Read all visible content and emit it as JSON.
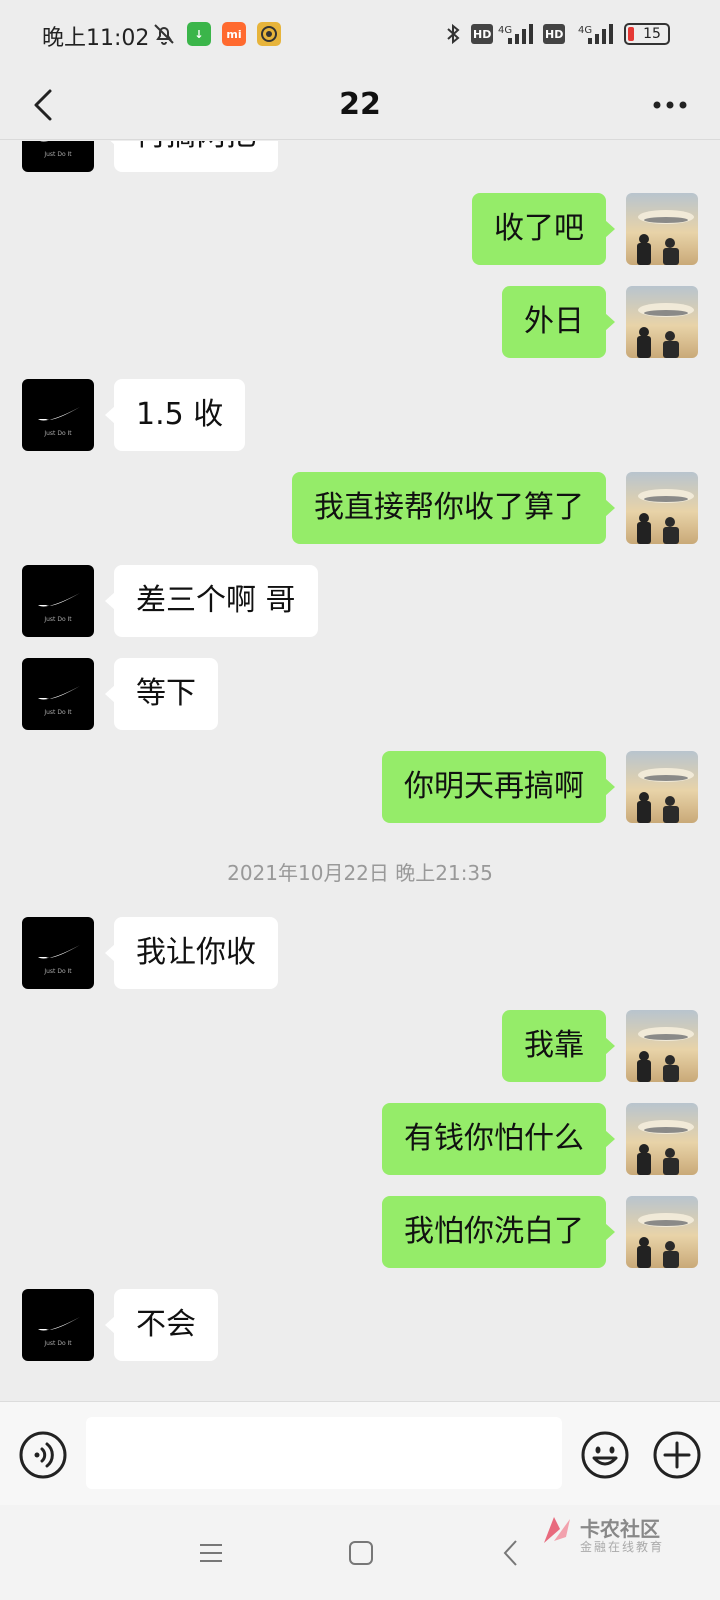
{
  "status_bar": {
    "time": "晚上11:02",
    "network_1": "4G",
    "network_2": "4G",
    "hd_label": "HD",
    "battery": "15",
    "mi_badge": "mi",
    "icons": [
      "mute-bell-icon",
      "download-icon",
      "mi-app-icon",
      "app-icon",
      "bluetooth-icon",
      "signal-icon",
      "battery-icon"
    ]
  },
  "header": {
    "title": "22",
    "back_icon": "chevron-left-icon",
    "more_icon": "more-dots-icon"
  },
  "messages": [
    {
      "side": "left",
      "text": "再搞两把"
    },
    {
      "side": "right",
      "text": "收了吧"
    },
    {
      "side": "right",
      "text": "外日"
    },
    {
      "side": "left",
      "text": "1.5 收"
    },
    {
      "side": "right",
      "text": "我直接帮你收了算了"
    },
    {
      "side": "left",
      "text": "差三个啊 哥"
    },
    {
      "side": "left",
      "text": "等下"
    },
    {
      "side": "right",
      "text": "你明天再搞啊"
    },
    {
      "side": "left",
      "text": "我让你收"
    },
    {
      "side": "right",
      "text": "我靠"
    },
    {
      "side": "right",
      "text": "有钱你怕什么"
    },
    {
      "side": "right",
      "text": "我怕你洗白了"
    },
    {
      "side": "left",
      "text": "不会"
    }
  ],
  "timestamp": "2021年10月22日 晚上21:35",
  "avatar_caption": "Just Do It",
  "input_bar": {
    "value": "",
    "voice_icon": "voice-icon",
    "emoji_icon": "emoji-icon",
    "plus_icon": "plus-icon"
  },
  "nav_bar": {
    "icons": [
      "menu-icon",
      "home-icon",
      "back-icon"
    ]
  },
  "watermark": {
    "title": "卡农社区",
    "subtitle": "金融在线教育"
  },
  "colors": {
    "background": "#ededed",
    "bubble_self": "#95ec69",
    "bubble_other": "#ffffff",
    "timestamp": "#999999"
  }
}
